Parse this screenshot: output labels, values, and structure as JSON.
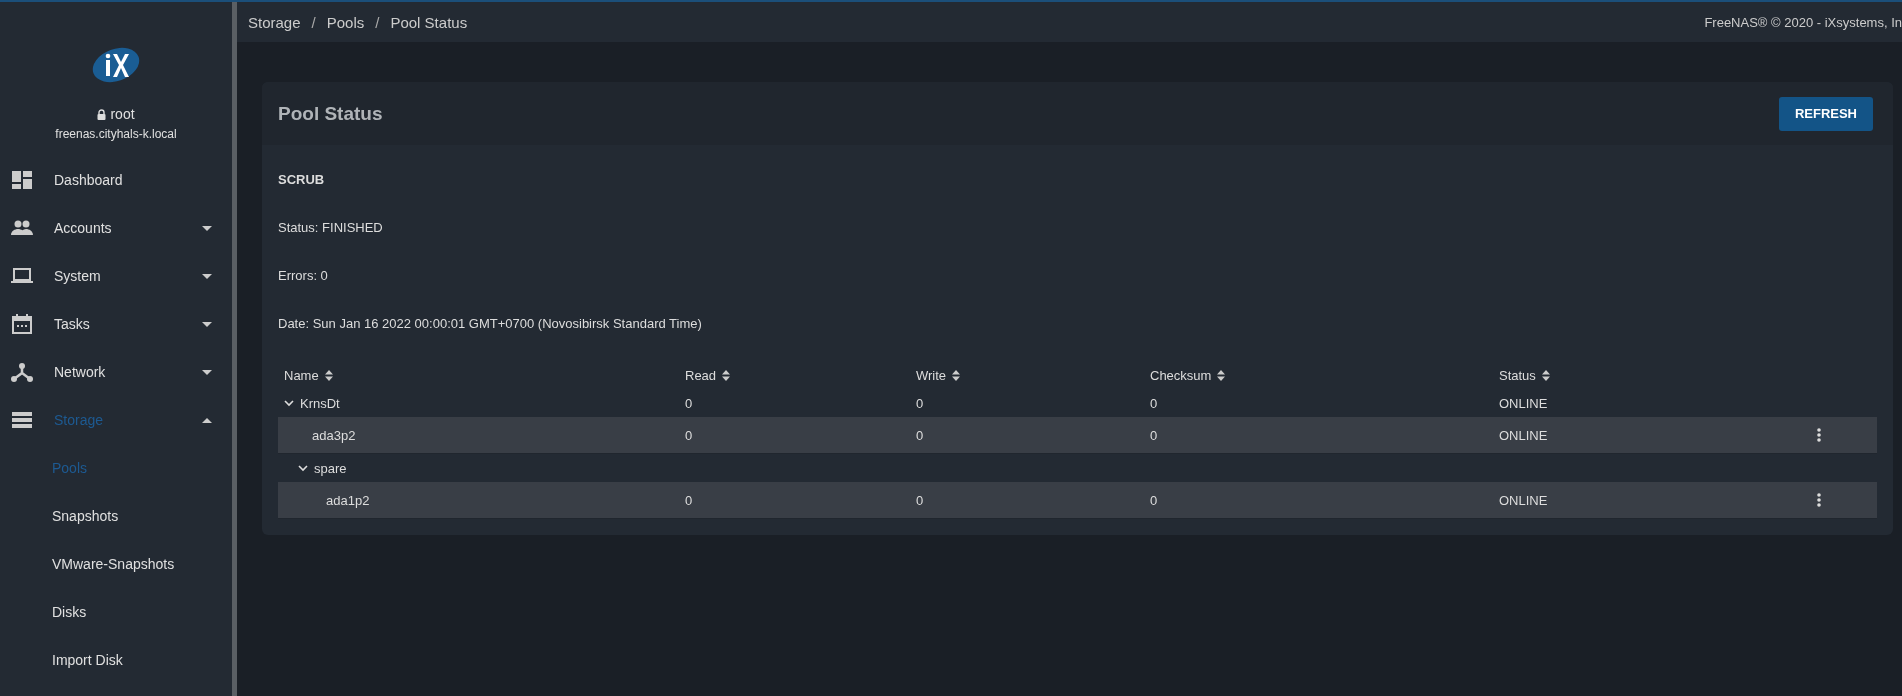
{
  "sidebar": {
    "user": "root",
    "hostname": "freenas.cityhals-k.local",
    "items": [
      {
        "kind": "link",
        "label": "Dashboard",
        "selected": false
      },
      {
        "kind": "group",
        "label": "Accounts",
        "selected": false,
        "expanded": false
      },
      {
        "kind": "group",
        "label": "System",
        "selected": false,
        "expanded": false
      },
      {
        "kind": "group",
        "label": "Tasks",
        "selected": false,
        "expanded": false
      },
      {
        "kind": "group",
        "label": "Network",
        "selected": false,
        "expanded": false
      },
      {
        "kind": "group",
        "label": "Storage",
        "selected": true,
        "expanded": true,
        "children": [
          {
            "label": "Pools",
            "selected": true
          },
          {
            "label": "Snapshots",
            "selected": false
          },
          {
            "label": "VMware-Snapshots",
            "selected": false
          },
          {
            "label": "Disks",
            "selected": false
          },
          {
            "label": "Import Disk",
            "selected": false
          }
        ]
      }
    ]
  },
  "breadcrumb": [
    "Storage",
    "Pools",
    "Pool Status"
  ],
  "breadcrumb_separator": "/",
  "copyright": "FreeNAS® © 2020 - iXsystems, In",
  "card": {
    "title": "Pool Status",
    "button": "REFRESH",
    "scrub": {
      "heading": "SCRUB",
      "lines": [
        "Status: FINISHED",
        "Errors: 0",
        "Date: Sun Jan 16 2022 00:00:01 GMT+0700 (Novosibirsk Standard Time)"
      ]
    }
  },
  "table": {
    "columns": [
      "Name",
      "Read",
      "Write",
      "Checksum",
      "Status"
    ],
    "rows": [
      {
        "name": "KrnsDt",
        "read": "0",
        "write": "0",
        "checksum": "0",
        "status": "ONLINE",
        "expanded": true,
        "children": [
          {
            "name": "ada3p2",
            "read": "0",
            "write": "0",
            "checksum": "0",
            "status": "ONLINE"
          },
          {
            "name": "spare",
            "expanded": true,
            "children": [
              {
                "name": "ada1p2",
                "read": "0",
                "write": "0",
                "checksum": "0",
                "status": "ONLINE"
              }
            ]
          }
        ]
      }
    ]
  }
}
